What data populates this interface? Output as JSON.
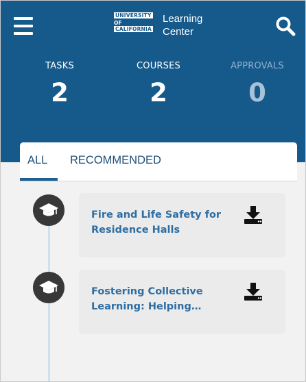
{
  "app": {
    "logo": {
      "line1": "UNIVERSITY",
      "line2": "OF",
      "line3": "CALIFORNIA",
      "title_line1": "Learning",
      "title_line2": "Center"
    },
    "brand_color": "#165a8c"
  },
  "stats": [
    {
      "label": "TASKS",
      "value": "2"
    },
    {
      "label": "COURSES",
      "value": "2"
    },
    {
      "label": "APPROVALS",
      "value": "0"
    }
  ],
  "tabs": {
    "all": "ALL",
    "recommended": "RECOMMENDED",
    "active": "ALL"
  },
  "courses": [
    {
      "title": "Fire and Life Safety for Residence Halls",
      "icon": "graduation-cap-icon",
      "action_icon": "download-icon"
    },
    {
      "title": "Fostering Collective Learning: Helping…",
      "icon": "graduation-cap-icon",
      "action_icon": "download-icon"
    }
  ]
}
